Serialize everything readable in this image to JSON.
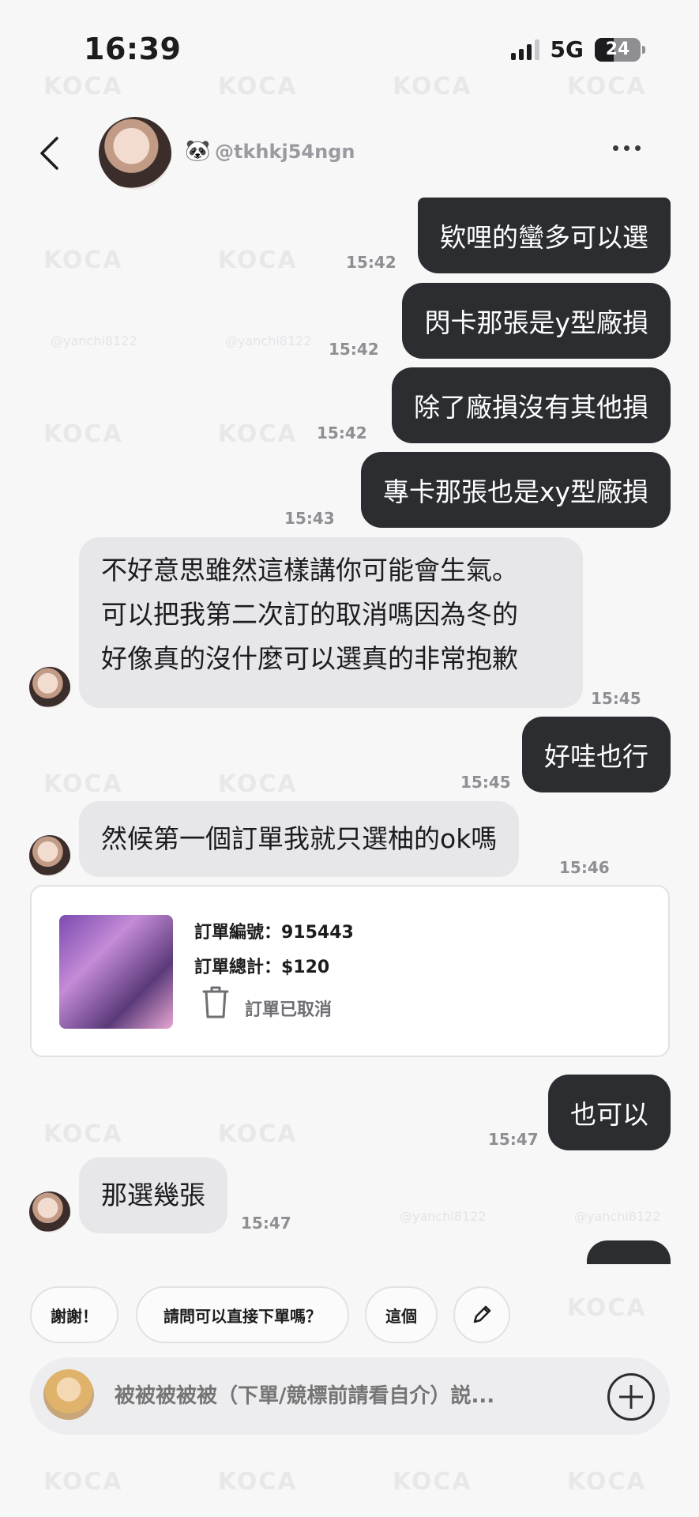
{
  "status_bar": {
    "time": "16:39",
    "network": "5G",
    "battery": "24"
  },
  "header": {
    "handle": "@tkhkj54ngn",
    "emoji": "🐼",
    "back_icon": "chevron-left-icon",
    "more_icon": "more-horizontal-icon"
  },
  "messages": {
    "m1": {
      "text": "欵哩的蠻多可以選",
      "time": "15:42"
    },
    "m2": {
      "text": "閃卡那張是y型廠損",
      "time": "15:42"
    },
    "m3": {
      "text": "除了廠損沒有其他損",
      "time": "15:42"
    },
    "m4": {
      "text": "專卡那張也是xy型廠損",
      "time": "15:43"
    },
    "m5": {
      "line1": "不好意思雖然這樣講你可能會生氣。",
      "line2": "可以把我第二次訂的取消嗎因為冬的",
      "line3": "好像真的沒什麼可以選真的非常抱歉",
      "time": "15:45"
    },
    "m6": {
      "text": "好哇也行",
      "time": "15:45"
    },
    "m7": {
      "text": "然候第一個訂單我就只選柚的ok嗎",
      "time": "15:46"
    },
    "m8": {
      "text": "也可以",
      "time": "15:47"
    },
    "m9": {
      "text": "那選幾張",
      "time": "15:47"
    }
  },
  "order_card": {
    "number": "訂單編號：915443",
    "total": "訂單總計：$120",
    "status": "訂單已取消"
  },
  "quick_replies": [
    "謝謝！",
    "請問可以直接下單嗎？",
    "這個"
  ],
  "input": {
    "placeholder": "被被被被被（下單/競標前請看自介）説..."
  },
  "watermark": {
    "logo": "KOCA",
    "handle": "@yanchi8122"
  },
  "colors": {
    "outgoing_bubble": "#2b2d31",
    "incoming_bubble": "#e7e7ea",
    "background": "#f7f7f8"
  }
}
